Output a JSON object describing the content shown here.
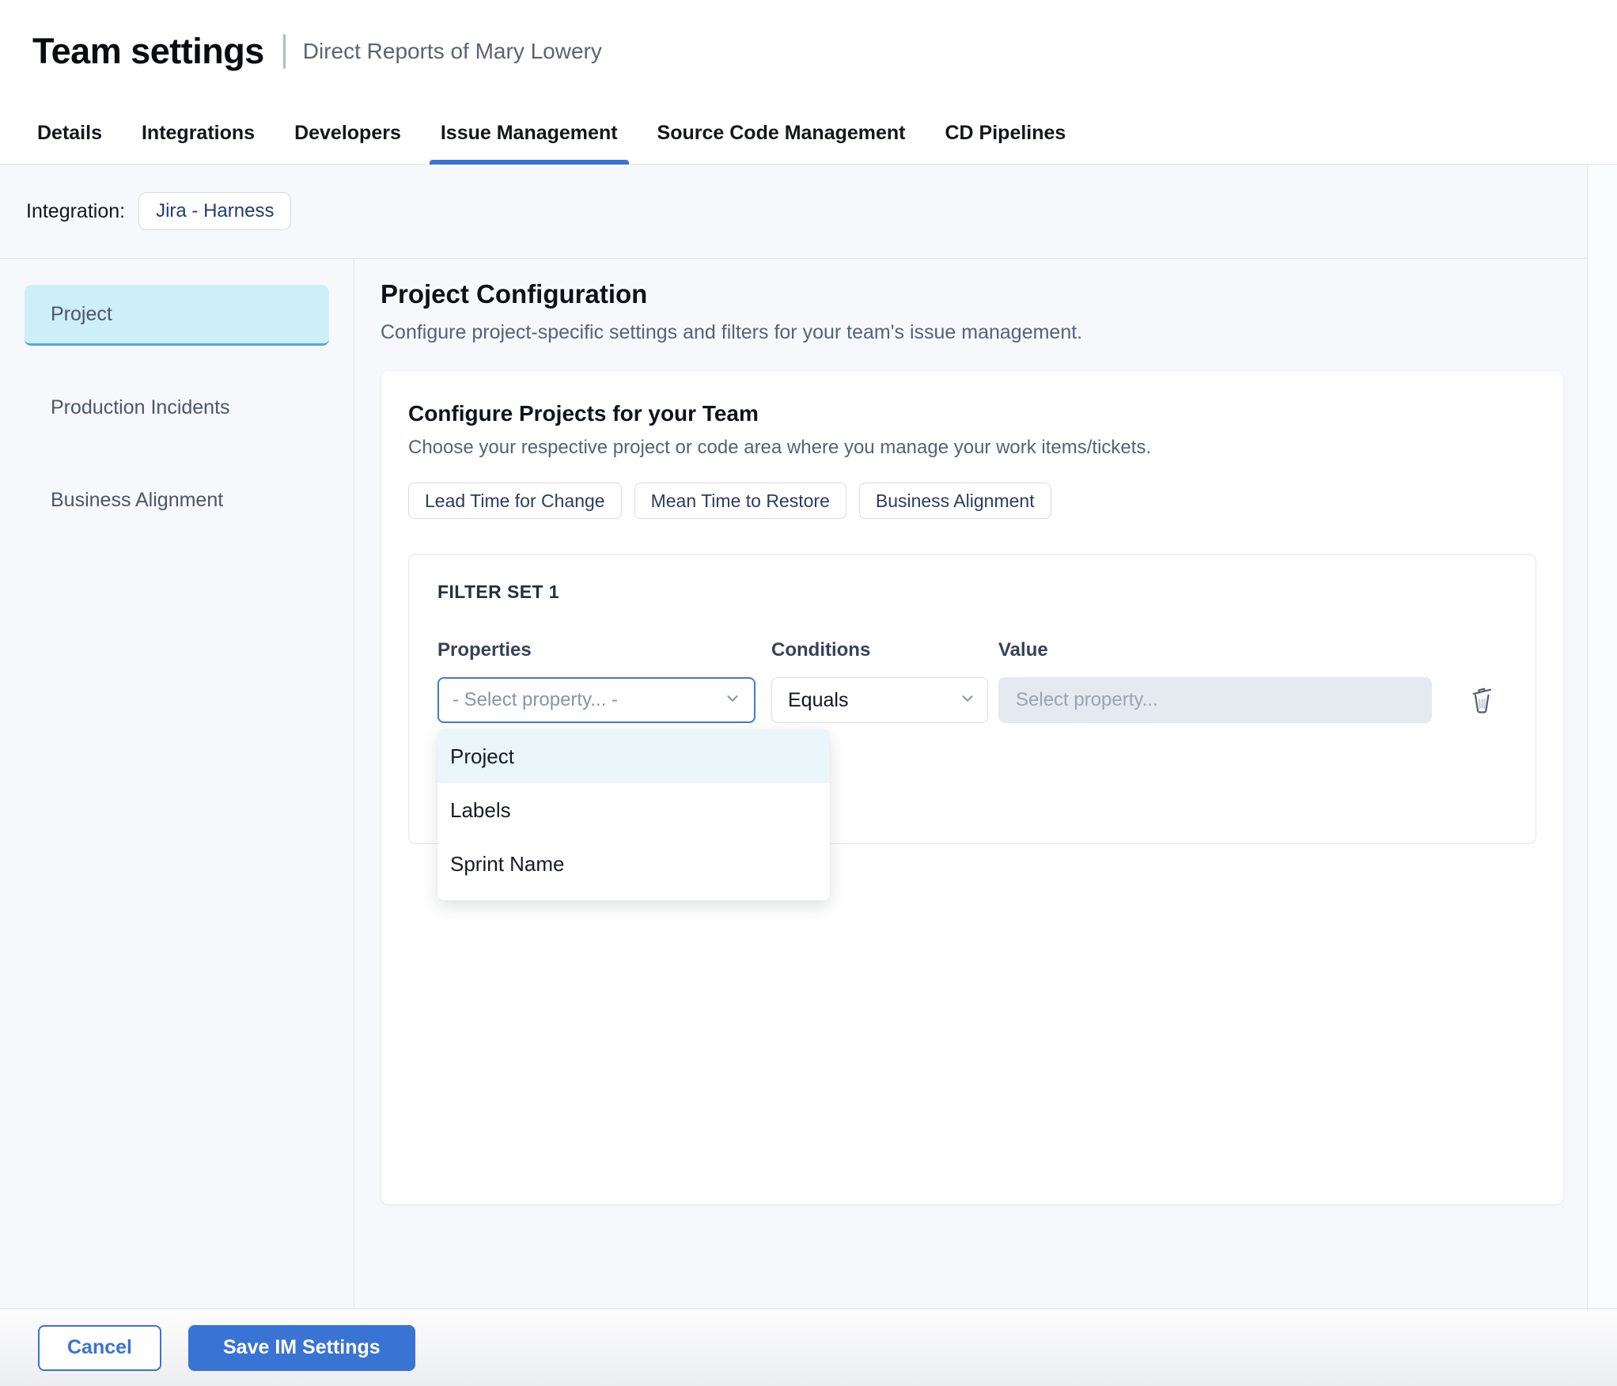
{
  "header": {
    "title": "Team settings",
    "subtitle": "Direct Reports of Mary Lowery"
  },
  "tabs": {
    "items": [
      {
        "label": "Details",
        "active": false
      },
      {
        "label": "Integrations",
        "active": false
      },
      {
        "label": "Developers",
        "active": false
      },
      {
        "label": "Issue Management",
        "active": true
      },
      {
        "label": "Source Code Management",
        "active": false
      },
      {
        "label": "CD Pipelines",
        "active": false
      }
    ]
  },
  "integration": {
    "label": "Integration:",
    "value": "Jira - Harness"
  },
  "sidebar": {
    "items": [
      {
        "label": "Project",
        "active": true
      },
      {
        "label": "Production Incidents",
        "active": false
      },
      {
        "label": "Business Alignment",
        "active": false
      }
    ]
  },
  "content": {
    "title": "Project Configuration",
    "subtitle": "Configure project-specific settings and filters for your team's issue management.",
    "card": {
      "title": "Configure Projects for your Team",
      "subtitle": "Choose your respective project or code area where you manage your work items/tickets.",
      "chips": [
        "Lead Time for Change",
        "Mean Time to Restore",
        "Business Alignment"
      ],
      "filter_set": {
        "title": "FILTER SET 1",
        "columns": {
          "properties": "Properties",
          "conditions": "Conditions",
          "value": "Value"
        },
        "property_placeholder": "- Select property... -",
        "condition_value": "Equals",
        "value_placeholder": "Select property...",
        "dropdown_options": [
          {
            "label": "Project",
            "highlighted": true
          },
          {
            "label": "Labels",
            "highlighted": false
          },
          {
            "label": "Sprint Name",
            "highlighted": false
          }
        ],
        "icons": {
          "delete": "trash-icon",
          "select_caret": "chevron-down-icon"
        }
      }
    }
  },
  "footer": {
    "cancel_label": "Cancel",
    "save_label": "Save IM Settings"
  },
  "colors": {
    "accent_blue": "#3973D3",
    "focus_border_blue": "#3D7BDC",
    "sidebar_active_bg": "#CDEFFA",
    "sidebar_active_border": "#54A9DD",
    "dropdown_highlight_bg": "#EBF6FB",
    "page_bg": "#F6F8FB",
    "disabled_input_bg": "#E4EAEF",
    "chip_text": "#2C3C5E"
  }
}
